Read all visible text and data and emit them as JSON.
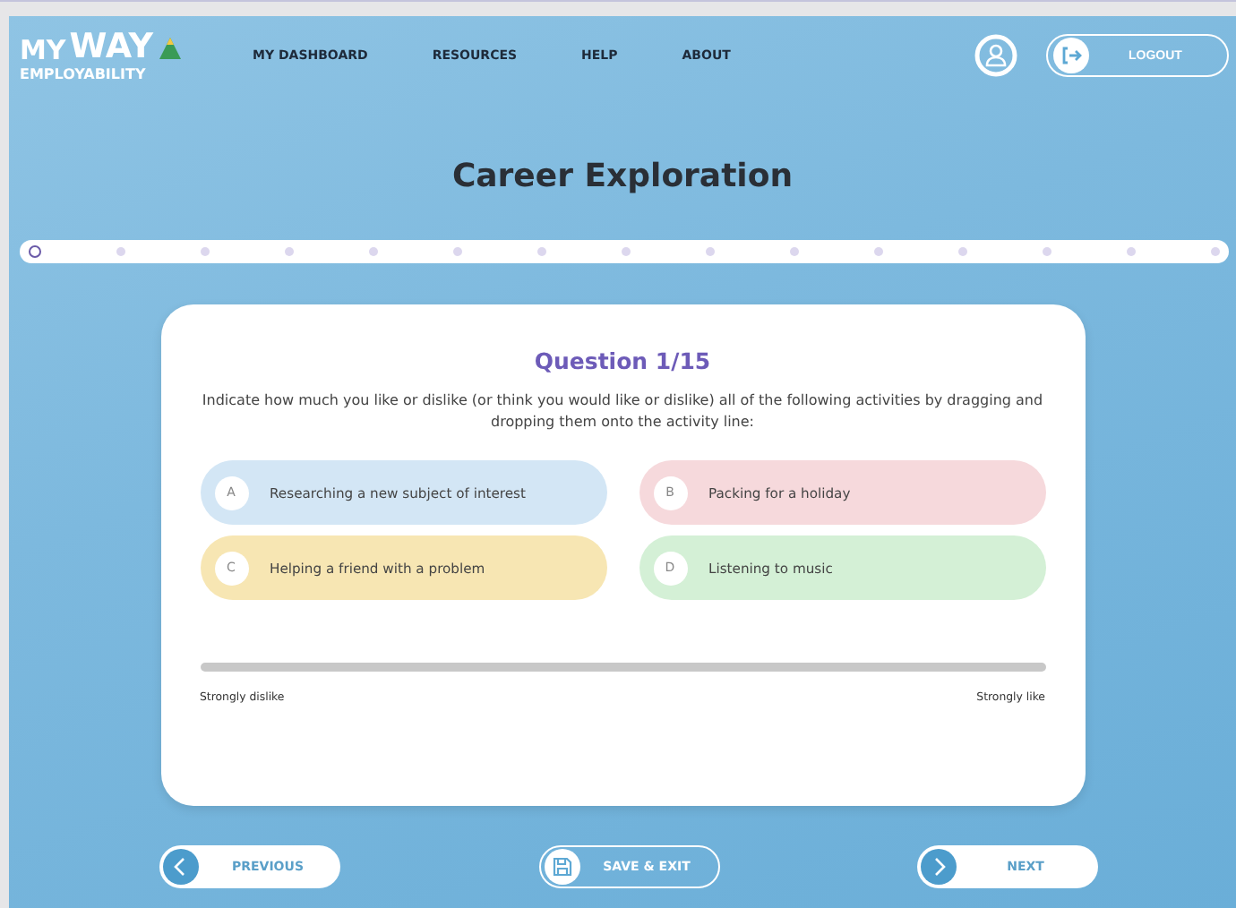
{
  "logo": {
    "top": "MY",
    "brand": "WAY",
    "sub": "EMPLOYABILITY"
  },
  "nav": [
    {
      "label": "MY DASHBOARD"
    },
    {
      "label": "RESOURCES"
    },
    {
      "label": "HELP"
    },
    {
      "label": "ABOUT"
    }
  ],
  "logout": {
    "label": "LOGOUT"
  },
  "title": "Career Exploration",
  "progress_steps": [
    {
      "selected": true
    },
    {
      "selected": false
    },
    {
      "selected": false
    },
    {
      "selected": false
    },
    {
      "selected": false
    },
    {
      "selected": false
    },
    {
      "selected": false
    },
    {
      "selected": false
    },
    {
      "selected": false
    },
    {
      "selected": false
    },
    {
      "selected": false
    },
    {
      "selected": false
    },
    {
      "selected": false
    },
    {
      "selected": false
    },
    {
      "selected": false
    }
  ],
  "question": {
    "heading": "Question 1/15",
    "instructions": "Indicate how much you like or dislike (or think you would like or dislike) all of the following activities by dragging and dropping them onto the activity line:",
    "options": [
      {
        "letter": "A",
        "text": "Researching a new subject of interest",
        "color": "#d3e6f5"
      },
      {
        "letter": "B",
        "text": "Packing for a holiday",
        "color": "#f6d9dc"
      },
      {
        "letter": "C",
        "text": "Helping a friend with a problem",
        "color": "#f7e6b3"
      },
      {
        "letter": "D",
        "text": "Listening to music",
        "color": "#d4f0d6"
      }
    ],
    "scale": {
      "left": "Strongly dislike",
      "right": "Strongly like"
    }
  },
  "footer_buttons": [
    {
      "kind": "previous",
      "label": "PREVIOUS"
    },
    {
      "kind": "save",
      "label": "SAVE & EXIT"
    },
    {
      "kind": "next",
      "label": "NEXT"
    }
  ]
}
